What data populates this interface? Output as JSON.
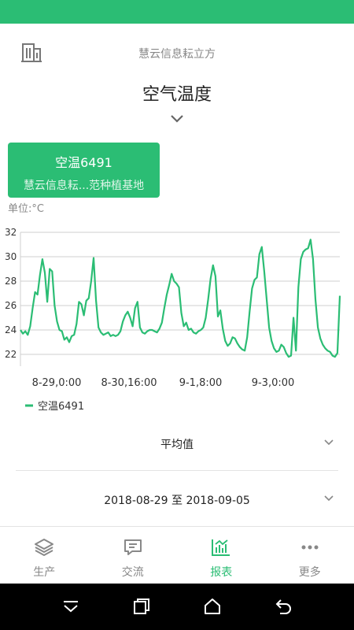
{
  "header": {
    "org_name": "慧云信息耘立方"
  },
  "page": {
    "title": "空气温度"
  },
  "device_card": {
    "name": "空温6491",
    "location": "慧云信息耘...范种植基地"
  },
  "unit_label": "单位:°C",
  "chart_data": {
    "type": "line",
    "x_ticks": [
      "8-29,0:00",
      "8-30,16:00",
      "9-1,8:00",
      "9-3,0:00"
    ],
    "y_ticks": [
      22,
      24,
      26,
      28,
      30,
      32
    ],
    "ylim": [
      21,
      32
    ],
    "grid": true,
    "legend_position": "bottom-left",
    "series": [
      {
        "name": "空温6491",
        "color": "#2bbd74",
        "values": [
          24.0,
          23.7,
          23.9,
          23.6,
          24.3,
          25.8,
          27.1,
          26.9,
          28.5,
          29.8,
          28.7,
          26.3,
          29.0,
          28.8,
          26.0,
          24.7,
          24.0,
          23.9,
          23.2,
          23.4,
          23.0,
          23.5,
          23.6,
          24.5,
          26.3,
          26.1,
          25.2,
          26.4,
          26.6,
          28.0,
          29.9,
          26.4,
          24.2,
          23.8,
          23.6,
          23.7,
          23.8,
          23.5,
          23.6,
          23.5,
          23.6,
          23.9,
          24.7,
          25.2,
          25.5,
          25.0,
          24.3,
          25.8,
          26.3,
          24.2,
          23.8,
          23.7,
          23.9,
          24.0,
          24.0,
          23.9,
          23.8,
          24.1,
          24.6,
          25.8,
          26.9,
          27.7,
          28.6,
          28.0,
          27.8,
          27.5,
          25.4,
          24.3,
          24.6,
          24.0,
          24.1,
          23.8,
          23.7,
          23.9,
          24.0,
          24.2,
          25.0,
          26.5,
          28.2,
          29.3,
          28.4,
          25.1,
          25.6,
          24.1,
          23.1,
          22.7,
          22.9,
          23.4,
          23.3,
          22.9,
          22.6,
          22.4,
          22.3,
          23.4,
          25.5,
          27.4,
          28.1,
          28.3,
          30.2,
          30.8,
          28.8,
          26.5,
          24.2,
          23.1,
          22.5,
          22.2,
          22.3,
          22.8,
          22.6,
          22.1,
          21.8,
          21.9,
          25.0,
          22.3,
          27.5,
          29.8,
          30.4,
          30.6,
          30.7,
          31.4,
          29.8,
          26.5,
          24.2,
          23.3,
          22.8,
          22.5,
          22.3,
          22.2,
          21.9,
          21.8,
          22.1,
          26.8
        ]
      }
    ]
  },
  "dropdowns": {
    "aggregate": "平均值",
    "date_range": "2018-08-29 至 2018-09-05"
  },
  "tabs": [
    {
      "label": "生产",
      "icon": "layers-icon",
      "active": false
    },
    {
      "label": "交流",
      "icon": "chat-icon",
      "active": false
    },
    {
      "label": "报表",
      "icon": "report-chart-icon",
      "active": true
    },
    {
      "label": "更多",
      "icon": "more-dots-icon",
      "active": false
    }
  ],
  "colors": {
    "brand_green": "#2bbd74",
    "inactive_gray": "#888888",
    "nav_black": "#000000"
  }
}
